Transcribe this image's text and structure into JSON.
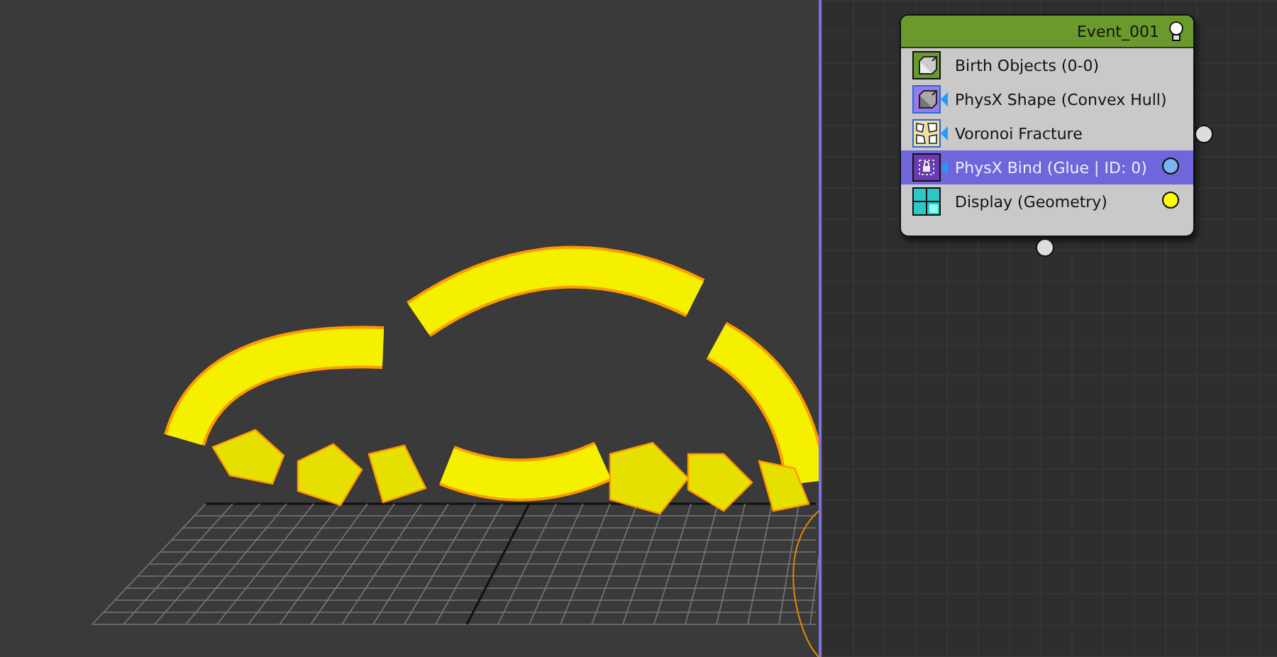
{
  "event_node": {
    "title": "Event_001",
    "operators": [
      {
        "kind": "birth",
        "label": "Birth Objects (0-0)",
        "selected": false,
        "wired": false
      },
      {
        "kind": "shape",
        "label": "PhysX Shape (Convex Hull)",
        "selected": false,
        "wired": true
      },
      {
        "kind": "fracture",
        "label": "Voronoi Fracture",
        "selected": false,
        "wired": true
      },
      {
        "kind": "bind",
        "label": "PhysX Bind (Glue | ID: 0)",
        "selected": true,
        "wired": true,
        "color": "#7ab3f0"
      },
      {
        "kind": "display",
        "label": "Display (Geometry)",
        "selected": false,
        "wired": false,
        "color": "#ffff00"
      }
    ]
  }
}
